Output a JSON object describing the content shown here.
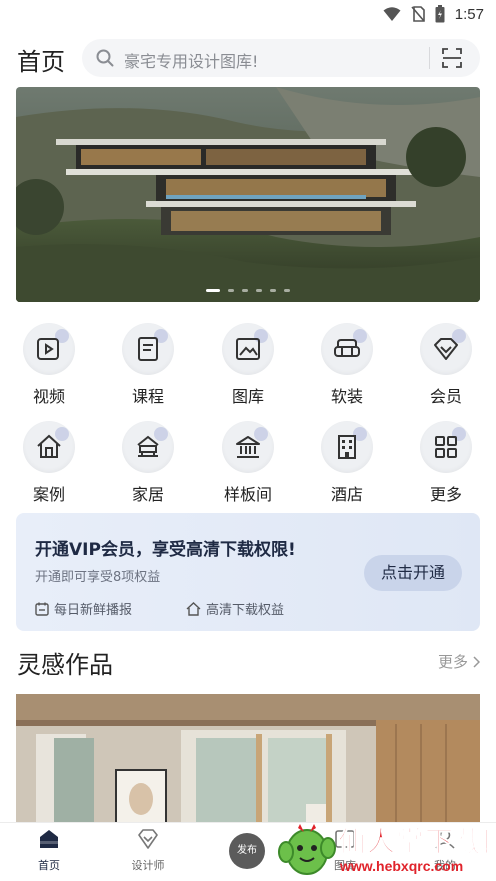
{
  "status": {
    "time": "1:57"
  },
  "header": {
    "title": "首页",
    "search_placeholder": "豪宅专用设计图库!"
  },
  "banner": {
    "slide_count": 6,
    "active_slide": 0
  },
  "categories": [
    {
      "label": "视频",
      "icon": "video-icon"
    },
    {
      "label": "课程",
      "icon": "course-icon"
    },
    {
      "label": "图库",
      "icon": "gallery-icon"
    },
    {
      "label": "软装",
      "icon": "sofa-icon"
    },
    {
      "label": "会员",
      "icon": "diamond-icon"
    },
    {
      "label": "案例",
      "icon": "house-icon"
    },
    {
      "label": "家居",
      "icon": "furniture-icon"
    },
    {
      "label": "样板间",
      "icon": "showroom-icon"
    },
    {
      "label": "酒店",
      "icon": "hotel-icon"
    },
    {
      "label": "更多",
      "icon": "grid-icon"
    }
  ],
  "vip": {
    "title": "开通VIP会员，享受高清下载权限!",
    "subtitle": "开通即可享受8项权益",
    "button": "点击开通",
    "features": [
      "每日新鲜播报",
      "高清下载权益"
    ]
  },
  "section": {
    "title": "灵感作品",
    "more": "更多"
  },
  "bottom_nav": {
    "items": [
      {
        "label": "首页",
        "icon": "home-icon"
      },
      {
        "label": "设计师",
        "icon": "designer-icon"
      },
      {
        "label": "发布",
        "icon": "publish-icon"
      },
      {
        "label": "图库",
        "icon": "gallery-icon"
      },
      {
        "label": "我的",
        "icon": "profile-icon"
      }
    ]
  },
  "watermark": {
    "text": "仙人掌下载网",
    "url": "www.hebxqrc.com"
  },
  "colors": {
    "accent": "#1f2a44",
    "vip_bg": "#e3eaf7",
    "watermark": "#e0232b"
  }
}
